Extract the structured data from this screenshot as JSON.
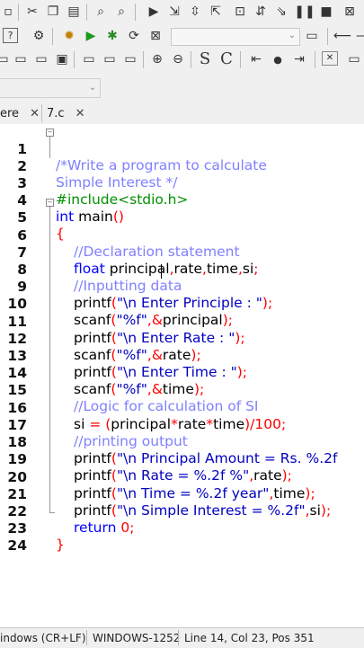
{
  "tabs": [
    {
      "label": "ere"
    },
    {
      "label": "7.c"
    }
  ],
  "code_lines": [
    {
      "n": "1"
    },
    {
      "n": "2"
    },
    {
      "n": "3"
    },
    {
      "n": "4"
    },
    {
      "n": "5"
    },
    {
      "n": "6"
    },
    {
      "n": "7"
    },
    {
      "n": "8"
    },
    {
      "n": "9"
    },
    {
      "n": "10"
    },
    {
      "n": "11"
    },
    {
      "n": "12"
    },
    {
      "n": "13"
    },
    {
      "n": "14"
    },
    {
      "n": "15"
    },
    {
      "n": "16"
    },
    {
      "n": "17"
    },
    {
      "n": "18"
    },
    {
      "n": "19"
    },
    {
      "n": "20"
    },
    {
      "n": "21"
    },
    {
      "n": "22"
    },
    {
      "n": "23"
    },
    {
      "n": "24"
    }
  ],
  "code": {
    "l1": "/*Write a program to calculate",
    "l2": "Simple Interest */",
    "l3": "#include<stdio.h>",
    "l4_kw": "int",
    "l4_id": " main",
    "l4_br": "()",
    "l5": "{",
    "l6": "//Declaration statement",
    "l7_kw": "float",
    "l7_a": " principal",
    "l7_c1": ",",
    "l7_b": "rate",
    "l7_c2": ",",
    "l7_c": "time",
    "l7_c3": ",",
    "l7_d": "si",
    "l7_e": ";",
    "l8": "//Inputting data",
    "l9_fn": "printf",
    "l9_p": "(",
    "l9_s": "\"\\n Enter Principle : \"",
    "l9_e": ");",
    "l10_fn": "scanf",
    "l10_p": "(",
    "l10_s": "\"%f\"",
    "l10_c": ",&",
    "l10_v": "principal",
    "l10_e": ");",
    "l11_fn": "printf",
    "l11_p": "(",
    "l11_s": "\"\\n Enter Rate : \"",
    "l11_e": ");",
    "l12_fn": "scanf",
    "l12_p": "(",
    "l12_s": "\"%f\"",
    "l12_c": ",&",
    "l12_v": "rate",
    "l12_e": ");",
    "l13_fn": "printf",
    "l13_p": "(",
    "l13_s": "\"\\n Enter Time : \"",
    "l13_e": ");",
    "l14_fn": "scanf",
    "l14_p": "(",
    "l14_s": "\"%f\"",
    "l14_c": ",&",
    "l14_v": "time",
    "l14_e": ");",
    "l15": "//Logic for calculation of SI",
    "l16_a": "si ",
    "l16_b": "= (",
    "l16_c": "principal",
    "l16_d": "*",
    "l16_e": "rate",
    "l16_f": "*",
    "l16_g": "time",
    "l16_h": ")/",
    "l16_i": "100",
    "l16_j": ";",
    "l17": "//printing output",
    "l18_fn": "printf",
    "l18_p": "(",
    "l18_s": "\"\\n Principal Amount = Rs. %.2f",
    "l19_fn": "printf",
    "l19_p": "(",
    "l19_s": "\"\\n Rate = %.2f %\"",
    "l19_c": ",",
    "l19_v": "rate",
    "l19_e": ");",
    "l20_fn": "printf",
    "l20_p": "(",
    "l20_s": "\"\\n Time = %.2f year\"",
    "l20_c": ",",
    "l20_v": "time",
    "l20_e": ");",
    "l21_fn": "printf",
    "l21_p": "(",
    "l21_s": "\"\\n Simple Interest = %.2f\"",
    "l21_c": ",",
    "l21_v": "si",
    "l21_e": ");",
    "l22_kw": "return",
    "l22_n": " 0",
    "l22_e": ";",
    "l23": "}"
  },
  "status": {
    "eol": "indows (CR+LF)",
    "encoding": "WINDOWS-1252",
    "position": "Line 14, Col 23, Pos 351"
  },
  "icons": [
    "cut-icon",
    "copy-icon",
    "paste-icon",
    "find-icon",
    "replace-icon",
    "run-icon",
    "settings-icon",
    "play-icon",
    "compile-icon",
    "stop-icon"
  ],
  "colors": {
    "keyword": "#0000ff",
    "comment": "#8080ff",
    "preprocessor": "#009000",
    "string": "#0000c0",
    "operator": "#ff0000"
  }
}
